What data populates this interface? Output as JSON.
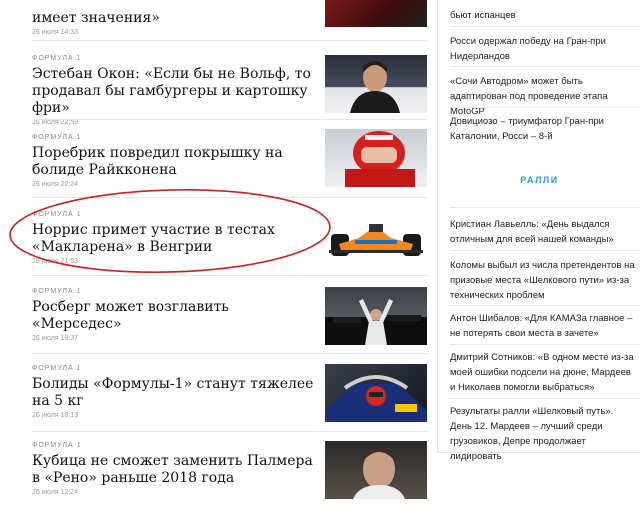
{
  "feed": {
    "top_partial": {
      "headline": "имеет значения»",
      "date": "26 июля 14:33"
    },
    "articles": [
      {
        "category": "Формула 1",
        "headline": "Эстебан Окон: «Если бы не Вольф, то продавал бы гамбургеры и картошку фри»",
        "date": "26 июля 22:59",
        "image": "driver-portrait-photo"
      },
      {
        "category": "Формула 1",
        "headline": "Поребрик повредил покрышку на болиде Райкконена",
        "date": "26 июля 22:24",
        "image": "driver-in-helmet-photo"
      },
      {
        "category": "Формула 1",
        "headline": "Норрис примет участие в тестах «Макларена» в Венгрии",
        "date": "26 июля 21:53",
        "image": "mclaren-car-photo"
      },
      {
        "category": "Формула 1",
        "headline": "Росберг может возглавить «Мерседес»",
        "date": "26 июля 19:37",
        "image": "celebration-photo"
      },
      {
        "category": "Формула 1",
        "headline": "Болиды «Формулы-1» станут тяжелее на 5 кг",
        "date": "26 июля 18:13",
        "image": "car-cockpit-photo"
      },
      {
        "category": "Формула 1",
        "headline": "Кубица не сможет заменить Палмера в «Рено» раньше 2018 года",
        "date": "26 июля 12:24",
        "image": "driver-face-photo"
      }
    ]
  },
  "sidebar": {
    "moto_items": [
      "бьют испанцев",
      "Росси одержал победу на Гран-при Нидерландов",
      "«Сочи Автодром» может быть адаптирован под проведение этапа MotoGP",
      "Довициозо – триумфатор Гран-при Каталонии, Росси – 8-й"
    ],
    "section_title": "РАЛЛИ",
    "rally_items": [
      "Кристиан Лавьелль: «День выдался отличным для всей нашей команды»",
      "Коломы выбыл из числа претендентов на призовые места «Шелкового пути» из-за технических проблем",
      "Антон Шибалов: «Для КАМАЗа главное – не потерять свои места в зачете»",
      "Дмитрий Сотников: «В одном месте из-за моей ошибки подсели на дюне, Мардеев и Николаев помогли выбраться»",
      "Результаты ралли «Шелковый путь». День 12. Мардеев – лучший среди грузовиков, Депре продолжает лидировать"
    ]
  },
  "colors": {
    "accent": "#1aa0d8",
    "annotation": "#cc1f1f",
    "mclaren_orange": "#f5871f"
  }
}
